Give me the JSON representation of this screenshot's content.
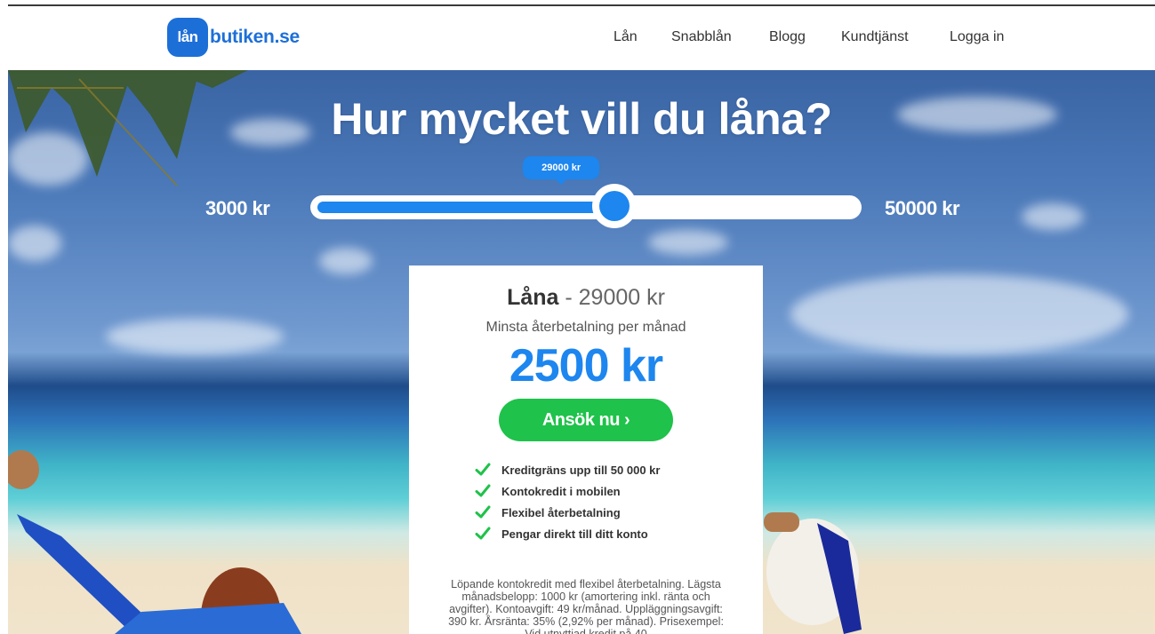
{
  "brand": {
    "badge": "lån",
    "name": "butiken.se"
  },
  "nav": {
    "items": [
      "Lån",
      "Snabblån",
      "Blogg",
      "Kundtjänst",
      "Logga in"
    ]
  },
  "hero": {
    "title": "Hur mycket vill du låna?",
    "slider": {
      "min_label": "3000 kr",
      "max_label": "50000 kr",
      "min": 3000,
      "max": 50000,
      "value": 29000,
      "value_label": "29000 kr"
    }
  },
  "card": {
    "heading_strong": "Låna",
    "heading_rest": "- 29000 kr",
    "subtitle": "Minsta återbetalning per månad",
    "monthly": "2500 kr",
    "apply_button": "Ansök nu ›",
    "features": [
      "Kreditgräns upp till 50 000 kr",
      "Kontokredit i mobilen",
      "Flexibel återbetalning",
      "Pengar direkt till ditt konto"
    ],
    "fineprint": "Löpande kontokredit med flexibel återbetalning. Lägsta månadsbelopp: 1000 kr (amortering inkl. ränta och avgifter). Kontoavgift: 49 kr/månad. Uppläggningsavgift: 390 kr. Årsränta: 35% (2,92% per månad). Prisexempel: Vid utnyttjad kredit på 40"
  },
  "colors": {
    "brand_blue": "#1d6fd8",
    "slider_blue": "#1d86ef",
    "cta_green": "#1fc24a",
    "check_green": "#1fc24a"
  },
  "icons": {
    "feature_check": "check-icon"
  }
}
